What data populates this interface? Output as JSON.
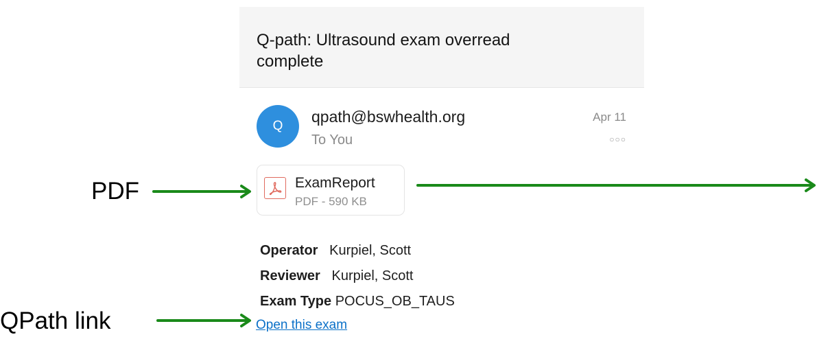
{
  "email": {
    "subject": "Q-path: Ultrasound exam overread complete",
    "avatar_letter": "Q",
    "sender": "qpath@bswhealth.org",
    "recipient": "To You",
    "date": "Apr 11",
    "more_icon": "ellipsis-icon"
  },
  "attachment": {
    "icon": "pdf-icon",
    "name": "ExamReport",
    "meta": "PDF - 590 KB"
  },
  "fields": [
    {
      "label": "Operator",
      "value": "Kurpiel, Scott"
    },
    {
      "label": "Reviewer",
      "value": "Kurpiel, Scott"
    },
    {
      "label": "Exam Type",
      "value": "POCUS_OB_TAUS"
    }
  ],
  "link_text": "Open this exam",
  "annotations": {
    "pdf_label": "PDF",
    "qpath_label": "QPath link",
    "arrow_color": "#1a8a1a"
  },
  "colors": {
    "avatar": "#2e8fde",
    "link": "#0a70c8",
    "pdf_red": "#e06a5e"
  }
}
